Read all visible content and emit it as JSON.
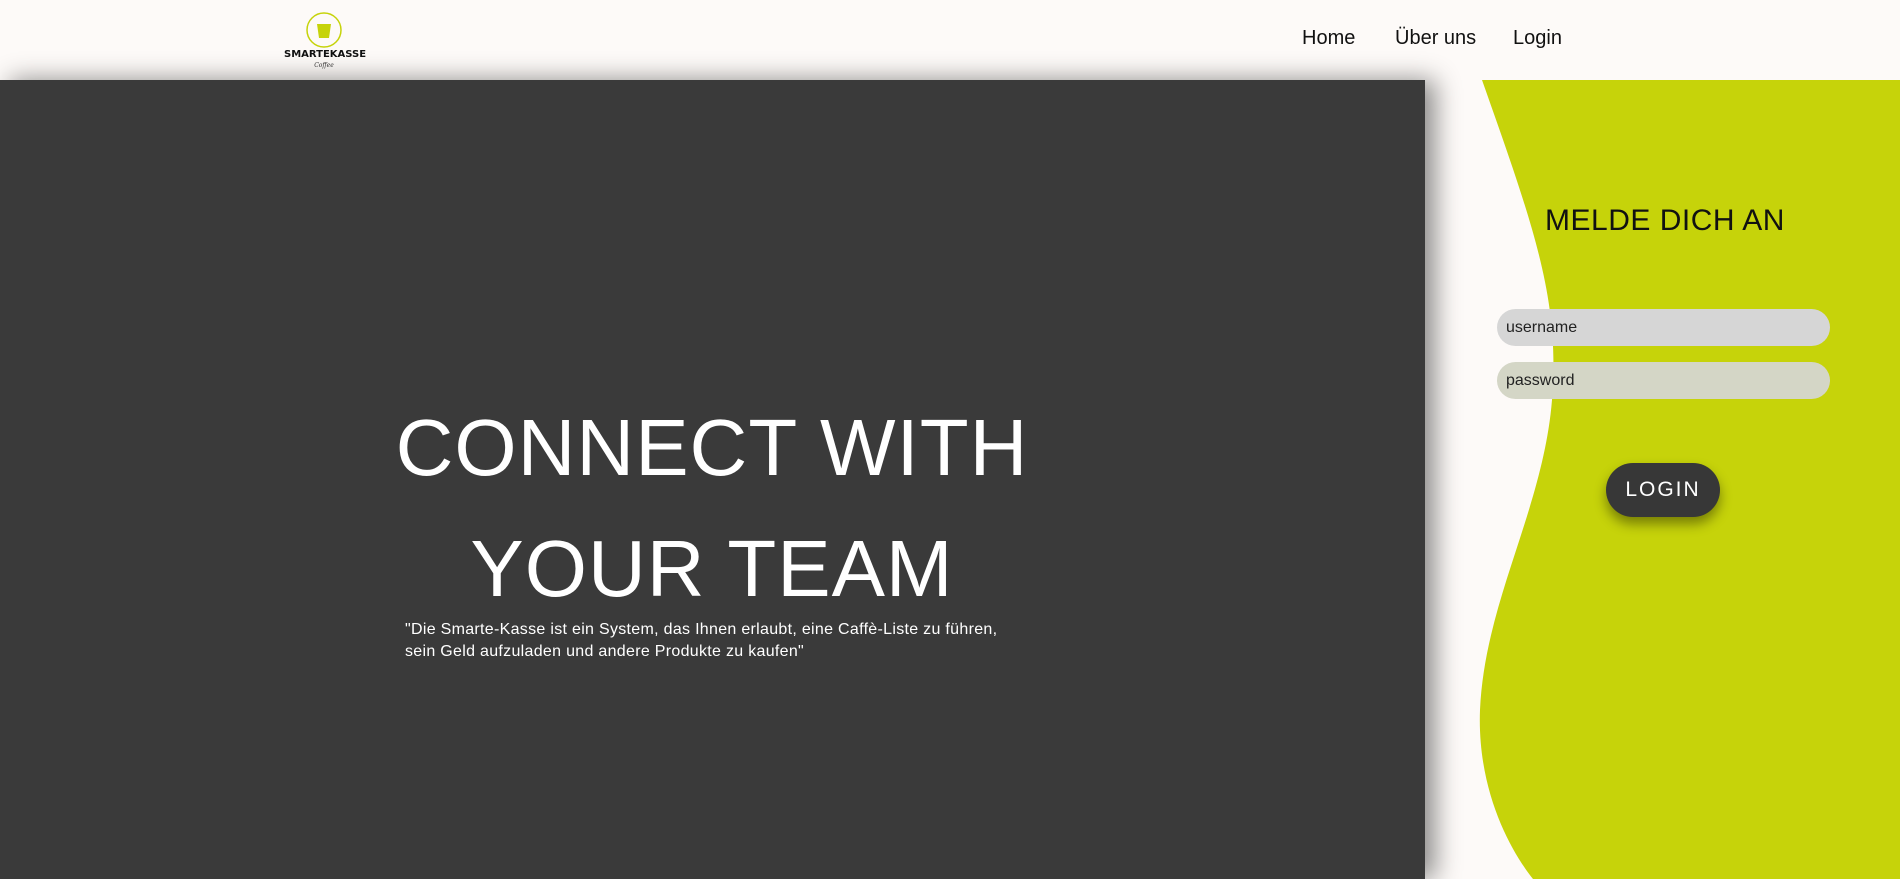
{
  "header": {
    "logo": {
      "name": "SMARTEKASSE",
      "sub": "Coffee",
      "icon": "cup-icon",
      "accent": "#c6d30a"
    },
    "nav": {
      "home": "Home",
      "about": "Über uns",
      "login": "Login"
    }
  },
  "hero": {
    "title_line1": "CONNECT WITH",
    "title_line2": "YOUR TEAM",
    "quote_line1": "\"Die Smarte-Kasse ist ein System, das Ihnen erlaubt, eine Caffè-Liste zu führen,",
    "quote_line2": "sein Geld aufzuladen und andere Produkte zu kaufen\"",
    "background": "#3a3a3a"
  },
  "login_panel": {
    "title": "MELDE DICH AN",
    "username_placeholder": "username",
    "password_placeholder": "password",
    "button": "LOGIN",
    "wave_color": "#c6d30a"
  }
}
